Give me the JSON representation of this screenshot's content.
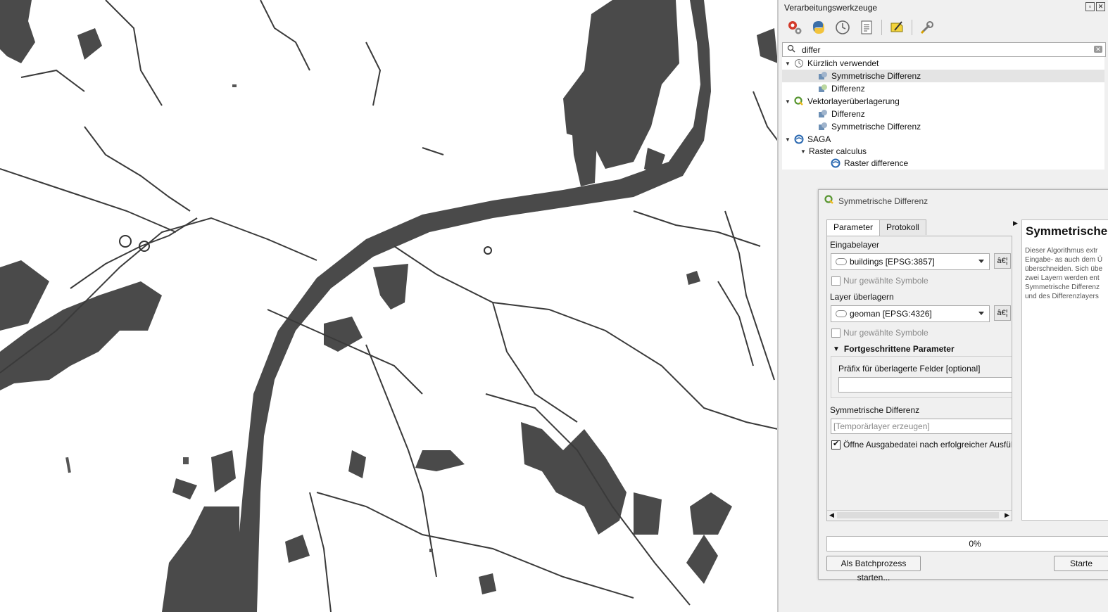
{
  "panel": {
    "title": "Verarbeitungswerkzeuge",
    "toolbar_icons": [
      "processing-models-icon",
      "python-icon",
      "history-clock-icon",
      "results-viewer-icon",
      "edit-features-icon",
      "options-wrench-icon"
    ],
    "search": {
      "value": "differ"
    }
  },
  "tree": {
    "recent": {
      "label": "Kürzlich verwendet",
      "items": [
        "Symmetrische Differenz",
        "Differenz"
      ]
    },
    "vector_overlay": {
      "label": "Vektorlayerüberlagerung",
      "items": [
        "Differenz",
        "Symmetrische Differenz"
      ]
    },
    "saga": {
      "label": "SAGA",
      "group": "Raster calculus",
      "items": [
        "Raster difference"
      ]
    }
  },
  "dialog": {
    "title": "Symmetrische Differenz",
    "tabs": [
      "Parameter",
      "Protokoll"
    ],
    "input_label": "Eingabelayer",
    "input_value": "buildings [EPSG:3857]",
    "dots": "â€¦",
    "only_selected": "Nur gewählte Symbole",
    "overlay_label": "Layer überlagern",
    "overlay_value": "geoman [EPSG:4326]",
    "advanced_label": "Fortgeschrittene Parameter",
    "prefix_label": "Präfix für überlagerte Felder [optional]",
    "output_label": "Symmetrische Differenz",
    "output_placeholder": "[Temporärlayer erzeugen]",
    "open_output_label": "Öffne Ausgabedatei nach erfolgreicher Ausführung",
    "open_output_checked": true,
    "progress": 0,
    "progress_text": "0%",
    "batch_button": "Als Batchprozess starten...",
    "run_button": "Starte",
    "help": {
      "title": "Symmetrische Differenz",
      "lines": [
        "Dieser Algorithmus extr",
        "Eingabe- as auch dem Ü",
        "überschneiden. Sich übe",
        "zwei Layern werden ent",
        "Symmetrische Differenz",
        "und des Differenzlayers"
      ]
    }
  }
}
